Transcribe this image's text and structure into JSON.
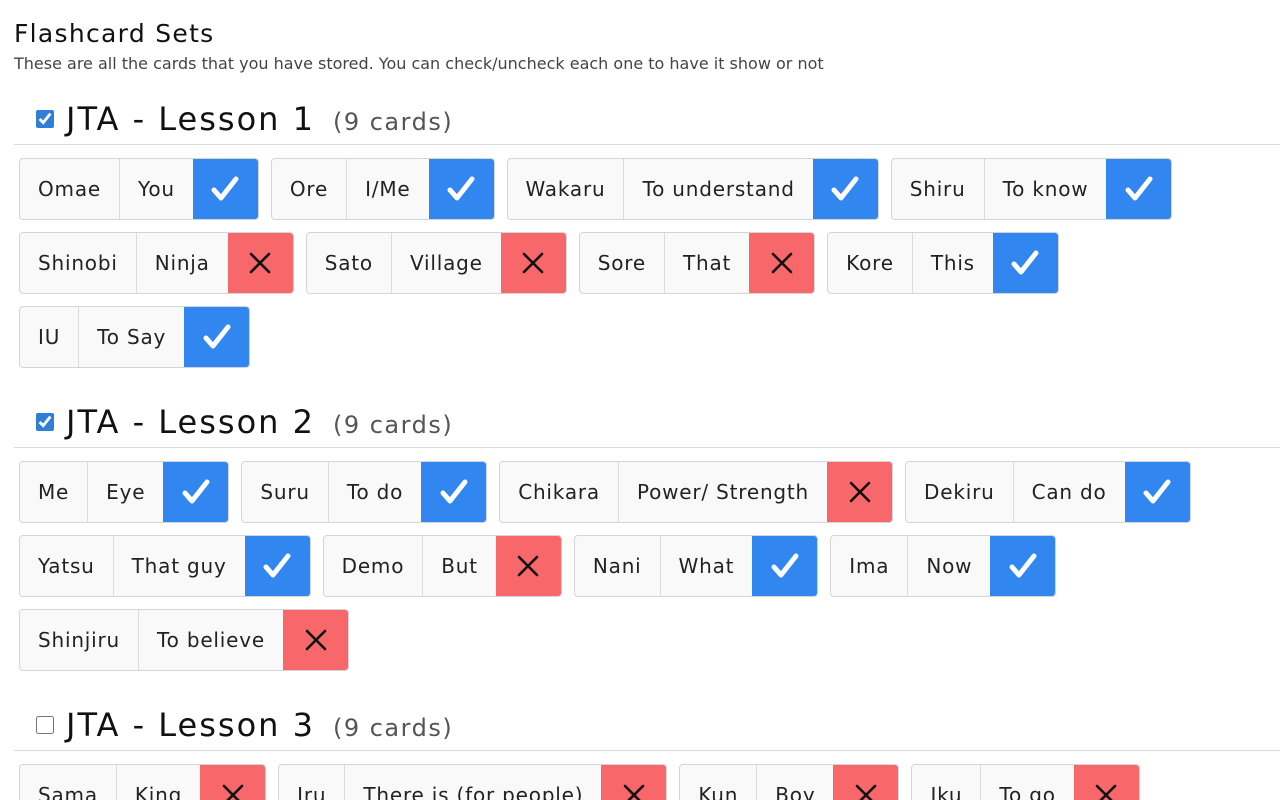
{
  "page": {
    "title": "Flashcard Sets",
    "subtitle": "These are all the cards that you have stored. You can check/uncheck each one to have it show or not"
  },
  "colors": {
    "enabled": "#3186ef",
    "disabled": "#f8676a",
    "card_background": "#f9f9f9"
  },
  "sets": [
    {
      "name": "JTA - Lesson 1",
      "count": "(9 cards)",
      "checked": true,
      "cards": [
        {
          "term": "Omae",
          "meaning": "You",
          "enabled": true
        },
        {
          "term": "Ore",
          "meaning": "I/Me",
          "enabled": true
        },
        {
          "term": "Wakaru",
          "meaning": "To understand",
          "enabled": true
        },
        {
          "term": "Shiru",
          "meaning": "To know",
          "enabled": true
        },
        {
          "term": "Shinobi",
          "meaning": "Ninja",
          "enabled": false
        },
        {
          "term": "Sato",
          "meaning": "Village",
          "enabled": false
        },
        {
          "term": "Sore",
          "meaning": "That",
          "enabled": false
        },
        {
          "term": "Kore",
          "meaning": "This",
          "enabled": true
        },
        {
          "term": "IU",
          "meaning": "To Say",
          "enabled": true
        }
      ]
    },
    {
      "name": "JTA - Lesson 2",
      "count": "(9 cards)",
      "checked": true,
      "cards": [
        {
          "term": "Me",
          "meaning": "Eye",
          "enabled": true
        },
        {
          "term": "Suru",
          "meaning": "To do",
          "enabled": true
        },
        {
          "term": "Chikara",
          "meaning": "Power/ Strength",
          "enabled": false
        },
        {
          "term": "Dekiru",
          "meaning": "Can do",
          "enabled": true
        },
        {
          "term": "Yatsu",
          "meaning": "That guy",
          "enabled": true
        },
        {
          "term": "Demo",
          "meaning": "But",
          "enabled": false
        },
        {
          "term": "Nani",
          "meaning": "What",
          "enabled": true
        },
        {
          "term": "Ima",
          "meaning": "Now",
          "enabled": true
        },
        {
          "term": "Shinjiru",
          "meaning": "To believe",
          "enabled": false
        }
      ]
    },
    {
      "name": "JTA - Lesson 3",
      "count": "(9 cards)",
      "checked": false,
      "cards": [
        {
          "term": "Sama",
          "meaning": "King",
          "enabled": false
        },
        {
          "term": "Iru",
          "meaning": "There is (for people)",
          "enabled": false
        },
        {
          "term": "Kun",
          "meaning": "Boy",
          "enabled": false
        },
        {
          "term": "Iku",
          "meaning": "To go",
          "enabled": false
        }
      ]
    }
  ]
}
